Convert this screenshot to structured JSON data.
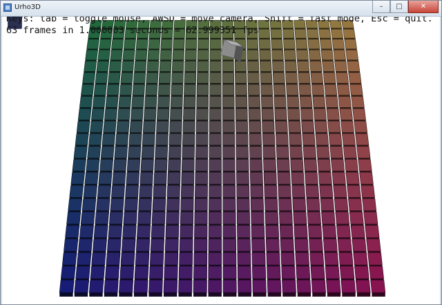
{
  "window": {
    "title": "Urho3D",
    "controls": {
      "minimize": "–",
      "maximize": "□",
      "close": "✕"
    }
  },
  "hud": {
    "keys_line": "Keys: tab = toggle mouse, AWSD = move camera, Shift = fast mode, Esc = quit.",
    "fps_line": "63 frames in 1.000003 seconds = 62.999351 fps"
  },
  "scene": {
    "grid_rows": 22,
    "grid_cols": 22,
    "colors": {
      "far_left": "#1e6b3a",
      "far_right": "#9a7a40",
      "near_left": "#141a78",
      "near_right": "#8a1050",
      "floating_cube": "#8c8c8c"
    }
  }
}
